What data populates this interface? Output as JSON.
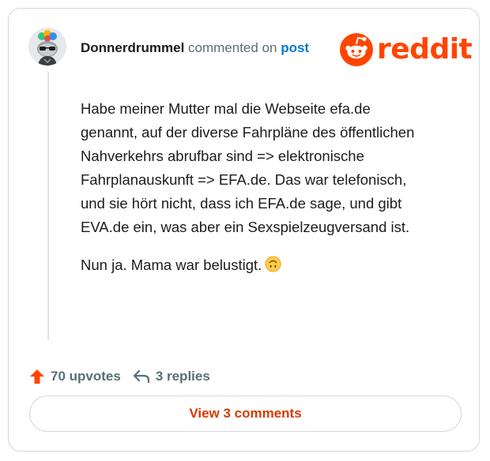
{
  "comment": {
    "username": "Donnerdrummel",
    "action_text": " commented on ",
    "post_link": "post",
    "paragraph_1": "Habe meiner Mutter mal die Webseite efa.de genannt, auf der diverse Fahrpläne des öffentlichen Nahverkehrs abrufbar sind => elektronische Fahrplanauskunft => EFA.de. Das war telefonisch, und sie hört nicht, dass ich EFA.de sage, und gibt EVA.de ein, was aber ein Sexspielzeugversand ist.",
    "paragraph_2": "Nun ja. Mama war belustigt.",
    "emoji": "upside-down-face-emoji"
  },
  "brand": {
    "logo_text": "reddit",
    "color": "#ff4500"
  },
  "actions": {
    "upvotes_label": "70 upvotes",
    "upvote_icon": "up-arrow-icon",
    "upvote_color": "#ff4500",
    "replies_label": "3 replies",
    "reply_icon": "reply-arrow-icon"
  },
  "view_button": {
    "label": "View 3 comments",
    "color": "#d93a00"
  }
}
